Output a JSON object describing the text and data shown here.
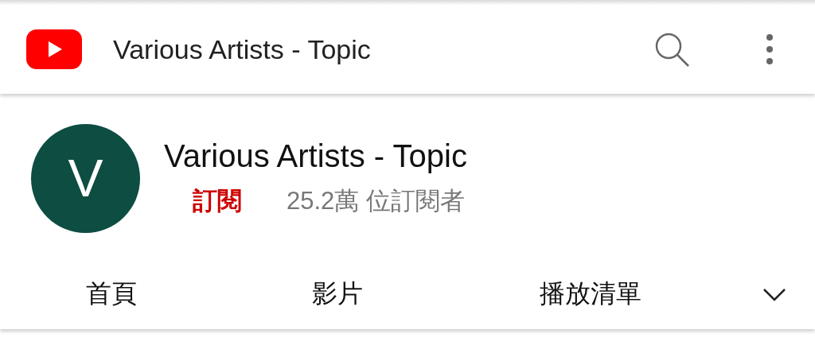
{
  "app_bar": {
    "title": "Various Artists - Topic"
  },
  "channel": {
    "avatar_letter": "V",
    "name": "Various Artists - Topic",
    "subscribe": "訂閱",
    "subscribers": "25.2萬 位訂閱者"
  },
  "tabs": [
    {
      "label": "首頁",
      "selected": false
    },
    {
      "label": "影片",
      "selected": false
    },
    {
      "label": "播放清單",
      "selected": false
    }
  ]
}
